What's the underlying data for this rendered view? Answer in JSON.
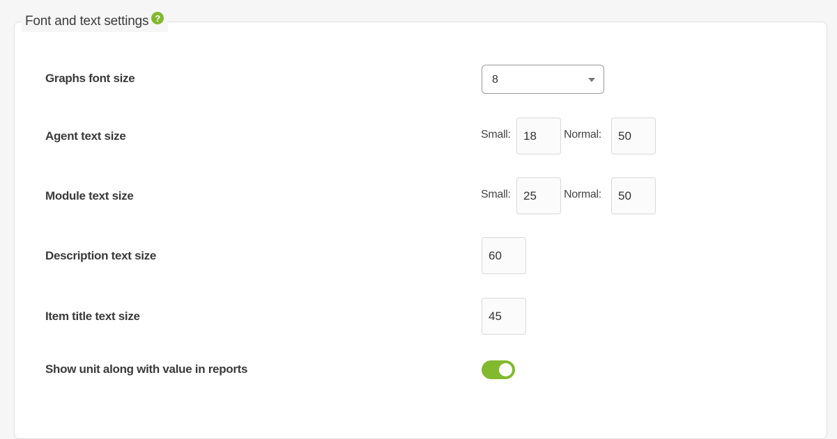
{
  "section": {
    "title": "Font and text settings",
    "help_icon": "?"
  },
  "rows": {
    "graphs_font_size": {
      "label": "Graphs font size",
      "value": "8"
    },
    "agent_text_size": {
      "label": "Agent text size",
      "small_label": "Small:",
      "small_value": "18",
      "normal_label": "Normal:",
      "normal_value": "50"
    },
    "module_text_size": {
      "label": "Module text size",
      "small_label": "Small:",
      "small_value": "25",
      "normal_label": "Normal:",
      "normal_value": "50"
    },
    "description_text_size": {
      "label": "Description text size",
      "value": "60"
    },
    "item_title_text_size": {
      "label": "Item title text size",
      "value": "45"
    },
    "show_unit": {
      "label": "Show unit along with value in reports",
      "checked": true
    }
  },
  "colors": {
    "accent": "#82b92e",
    "panel_bg": "#ffffff",
    "page_bg": "#f6f6f6"
  },
  "icons": {
    "help": "help-icon",
    "dropdown": "chevron-down-icon"
  }
}
